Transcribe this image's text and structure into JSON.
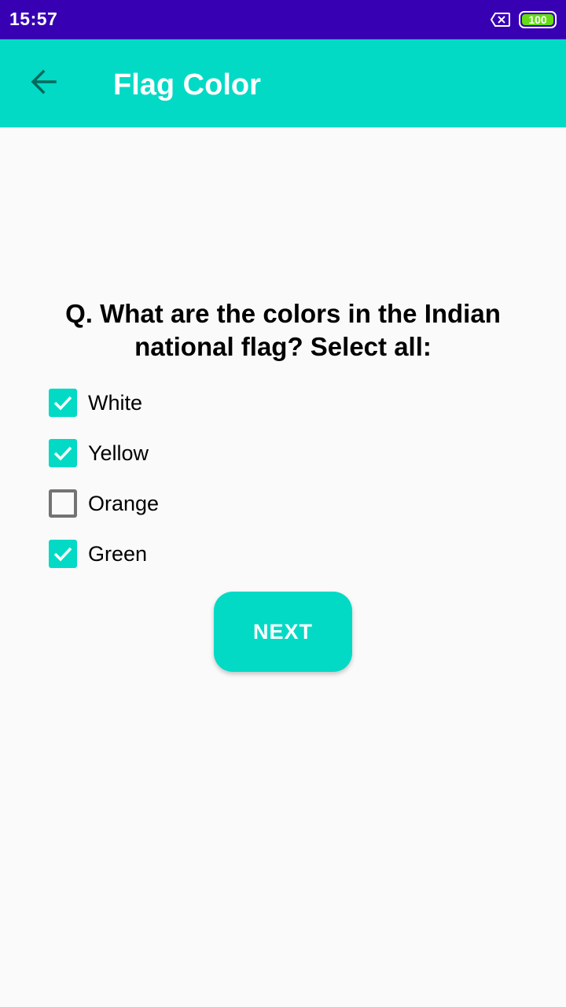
{
  "status_bar": {
    "time": "15:57",
    "battery_level": "100",
    "icons": [
      "sim-x-icon",
      "battery-icon"
    ]
  },
  "app_bar": {
    "title": "Flag Color",
    "back_icon": "arrow-left-icon"
  },
  "question": {
    "text": "Q. What are the colors in the Indian national flag? Select all:"
  },
  "options": [
    {
      "label": "White",
      "checked": true
    },
    {
      "label": "Yellow",
      "checked": true
    },
    {
      "label": "Orange",
      "checked": false
    },
    {
      "label": "Green",
      "checked": true
    }
  ],
  "next_button": {
    "label": "NEXT"
  },
  "colors": {
    "status_bar": "#3700b3",
    "accent": "#03dac5",
    "background": "#fafafa",
    "battery_fill": "#64dd17"
  }
}
